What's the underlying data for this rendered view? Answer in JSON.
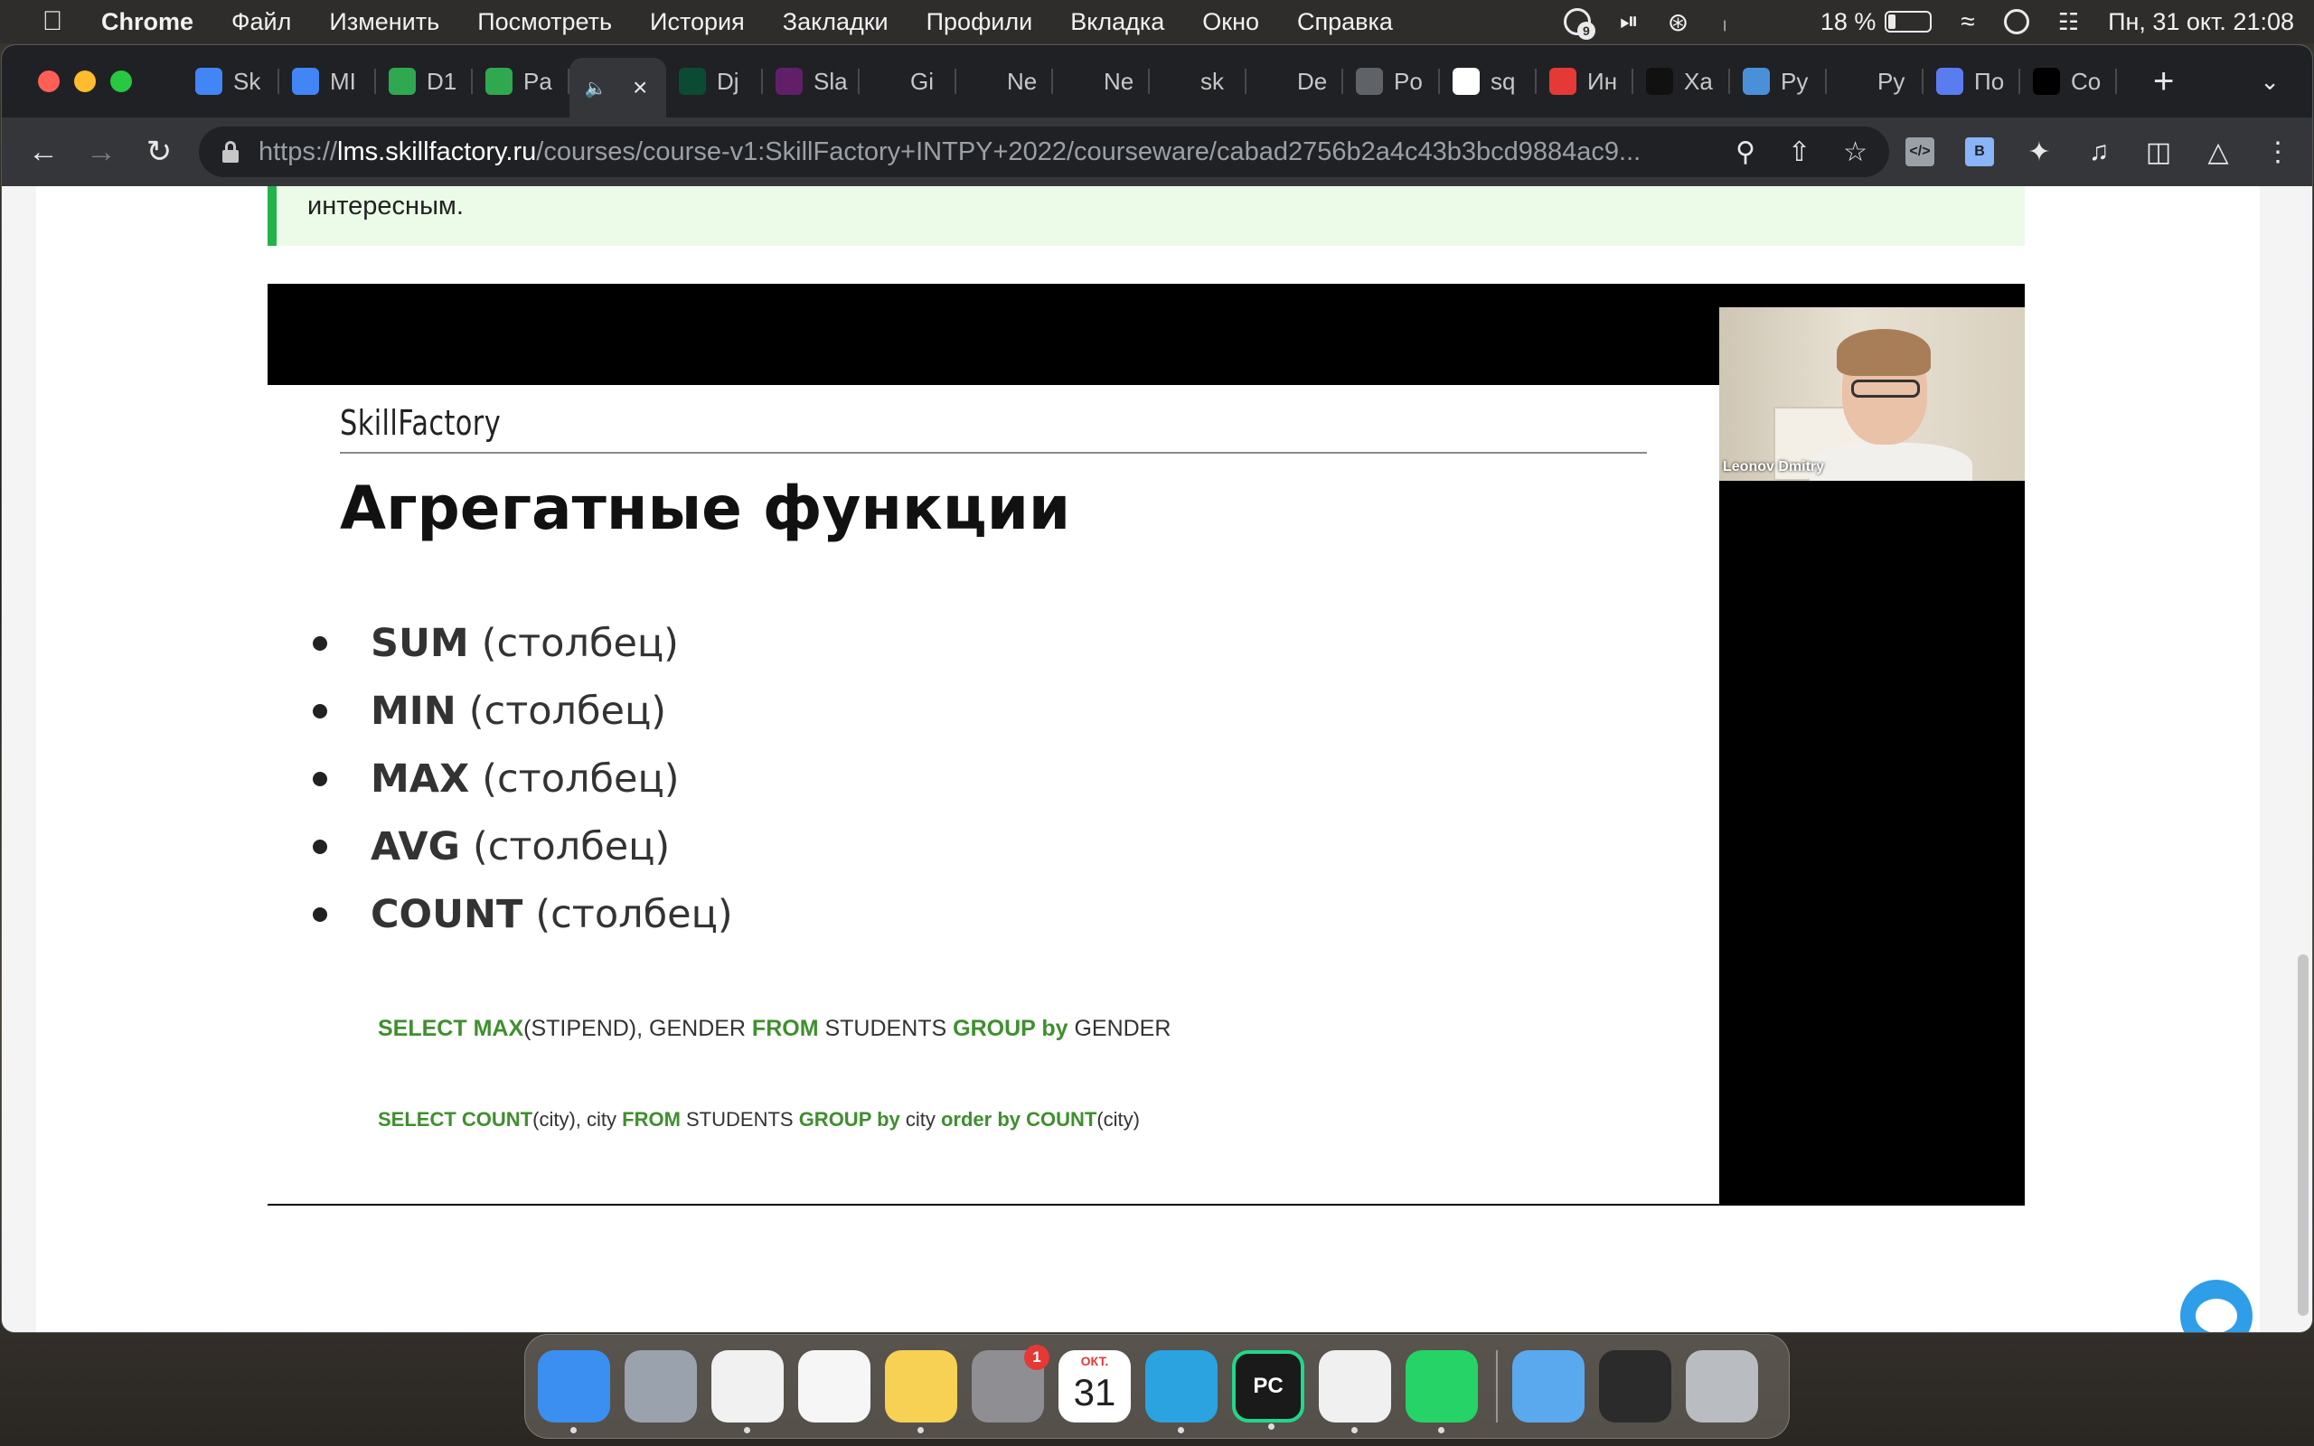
{
  "menubar": {
    "app_name": "Chrome",
    "menus": [
      "Файл",
      "Изменить",
      "Посмотреть",
      "История",
      "Закладки",
      "Профили",
      "Вкладка",
      "Окно",
      "Справка"
    ],
    "notification_count": "9",
    "battery_percent": "18 %",
    "battery_level": 0.18,
    "datetime": "Пн, 31 окт.  21:08"
  },
  "tabs": [
    {
      "label": "Sk",
      "icon": "google-docs-icon",
      "color": "#4285f4"
    },
    {
      "label": "MI",
      "icon": "google-docs-icon",
      "color": "#4285f4"
    },
    {
      "label": "D1",
      "icon": "skillfactory-icon",
      "color": "#2fa84f"
    },
    {
      "label": "Pa",
      "icon": "skillfactory-icon",
      "color": "#2fa84f"
    },
    {
      "label": "",
      "icon": "speaker-icon",
      "color": "#35363a",
      "active": true
    },
    {
      "label": "Dj",
      "icon": "django-icon",
      "color": "#0c4b33"
    },
    {
      "label": "Sla",
      "icon": "slack-icon",
      "color": "#611f69"
    },
    {
      "label": "Gi",
      "icon": "github-icon",
      "color": "#202124"
    },
    {
      "label": "Ne",
      "icon": "github-icon",
      "color": "#202124"
    },
    {
      "label": "Ne",
      "icon": "github-icon",
      "color": "#202124"
    },
    {
      "label": "sk",
      "icon": "github-icon",
      "color": "#202124"
    },
    {
      "label": "De",
      "icon": "slash-icon",
      "color": "#202124"
    },
    {
      "label": "Po",
      "icon": "globe-icon",
      "color": "#5f6368"
    },
    {
      "label": "sq",
      "icon": "google-icon",
      "color": "#ffffff"
    },
    {
      "label": "Ин",
      "icon": "search-q-icon",
      "color": "#e53935"
    },
    {
      "label": "Ха",
      "icon": "hexlet-icon",
      "color": "#111111"
    },
    {
      "label": "Py",
      "icon": "gear-app-icon",
      "color": "#4a90d9"
    },
    {
      "label": "Py",
      "icon": "m-icon",
      "color": "#202124"
    },
    {
      "label": "По",
      "icon": "compass-icon",
      "color": "#5b7cf0"
    },
    {
      "label": "Co",
      "icon": "jetbrains-icon",
      "color": "#000000"
    }
  ],
  "url": {
    "scheme": "https://",
    "host": "lms.skillfactory.ru",
    "path": "/courses/course-v1:SkillFactory+INTPY+2022/courseware/cabad2756b2a4c43b3bcd9884ac9..."
  },
  "callout": {
    "text": "интересным."
  },
  "slide": {
    "logo": "SkillFactory",
    "title": "Агрегатные функции",
    "functions": [
      {
        "name": "SUM",
        "arg": "(столбец)"
      },
      {
        "name": "MIN",
        "arg": "(столбец)"
      },
      {
        "name": "MAX",
        "arg": "(столбец)"
      },
      {
        "name": "AVG",
        "arg": "(столбец)"
      },
      {
        "name": "COUNT",
        "arg": "(столбец)"
      }
    ],
    "sql1": [
      {
        "t": "SELECT MAX",
        "kw": true
      },
      {
        "t": "(STIPEND), GENDER ",
        "kw": false
      },
      {
        "t": "FROM",
        "kw": true
      },
      {
        "t": " STUDENTS ",
        "kw": false
      },
      {
        "t": "GROUP by",
        "kw": true
      },
      {
        "t": " GENDER",
        "kw": false
      }
    ],
    "sql2": [
      {
        "t": "SELECT COUNT",
        "kw": true
      },
      {
        "t": "(city), city ",
        "kw": false
      },
      {
        "t": "FROM",
        "kw": true
      },
      {
        "t": " STUDENTS ",
        "kw": false
      },
      {
        "t": "GROUP by",
        "kw": true
      },
      {
        "t": " city ",
        "kw": false
      },
      {
        "t": "order by COUNT",
        "kw": true
      },
      {
        "t": "(city)",
        "kw": false
      }
    ]
  },
  "webcam": {
    "name": "Leonov Dmitry"
  },
  "dock": {
    "apps": [
      {
        "name": "finder",
        "color": "#3b8ff0",
        "dot": true
      },
      {
        "name": "launchpad",
        "color": "#9aa3ad",
        "dot": false
      },
      {
        "name": "chrome",
        "color": "#f1f1f1",
        "dot": true
      },
      {
        "name": "photos",
        "color": "#f6f6f6",
        "dot": false
      },
      {
        "name": "notes",
        "color": "#f7d154",
        "dot": true
      },
      {
        "name": "system-settings",
        "color": "#8e8e93",
        "dot": false,
        "badge": "1"
      },
      {
        "name": "calendar",
        "color": "#ffffff",
        "dot": false,
        "month": "ОКТ.",
        "day": "31"
      },
      {
        "name": "telegram",
        "color": "#2aa3e0",
        "dot": true
      },
      {
        "name": "pycharm",
        "color": "#1a1a1a",
        "dot": true
      },
      {
        "name": "textedit",
        "color": "#f0f0f0",
        "dot": true
      },
      {
        "name": "whatsapp",
        "color": "#25d366",
        "dot": true
      }
    ],
    "extras": [
      {
        "name": "downloads-folder",
        "color": "#5aa9ee"
      },
      {
        "name": "terminal-window",
        "color": "#2b2b2b"
      },
      {
        "name": "trash",
        "color": "#b9bcc0"
      }
    ]
  }
}
